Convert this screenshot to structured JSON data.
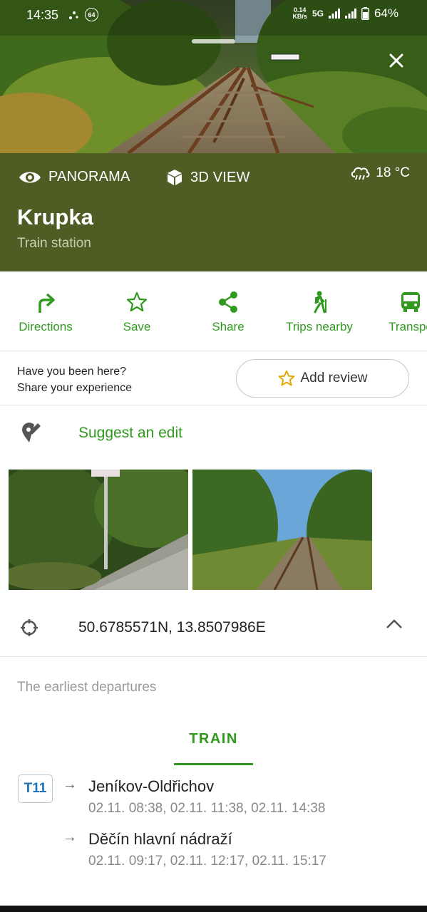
{
  "status_bar": {
    "time": "14:35",
    "notification_badge": "64",
    "data_rate_value": "0.14",
    "data_rate_unit": "KB/s",
    "network": "5G",
    "battery": "64%"
  },
  "place": {
    "panorama_label": "PANORAMA",
    "view3d_label": "3D VIEW",
    "weather_temp": "18 °C",
    "title": "Krupka",
    "subtitle": "Train station"
  },
  "actions": [
    {
      "label": "Directions",
      "icon": "directions-icon"
    },
    {
      "label": "Save",
      "icon": "star-icon"
    },
    {
      "label": "Share",
      "icon": "share-icon"
    },
    {
      "label": "Trips nearby",
      "icon": "hiker-icon"
    },
    {
      "label": "Transpo",
      "icon": "bus-icon"
    }
  ],
  "review": {
    "prompt_line1": "Have you been here?",
    "prompt_line2": "Share your experience",
    "button_label": "Add review"
  },
  "suggest_edit_label": "Suggest an edit",
  "coordinates": "50.6785571N, 13.8507986E",
  "departures": {
    "heading": "The earliest departures",
    "tab": "TRAIN",
    "line": "T11",
    "items": [
      {
        "destination": "Jeníkov-Oldřichov",
        "times": "02.11. 08:38, 02.11. 11:38, 02.11. 14:38"
      },
      {
        "destination": "Děčín hlavní nádraží",
        "times": "02.11. 09:17, 02.11. 12:17, 02.11. 15:17"
      }
    ]
  },
  "colors": {
    "accent_green": "#2f9a1e",
    "panel_olive": "#4f5c24",
    "line_blue": "#1a73b8"
  },
  "arrow_glyph": "→"
}
